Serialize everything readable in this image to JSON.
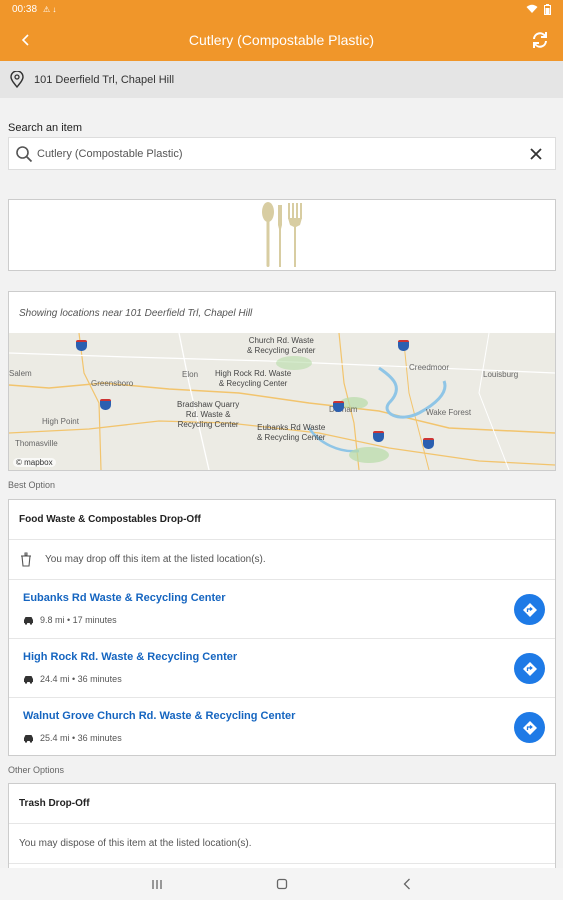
{
  "status": {
    "time": "00:38",
    "left_icons": "⚠ ↓"
  },
  "header": {
    "title": "Cutlery (Compostable Plastic)"
  },
  "address": {
    "text": "101 Deerfield Trl, Chapel Hill"
  },
  "search": {
    "label": "Search an item",
    "value": "Cutlery (Compostable Plastic)"
  },
  "map": {
    "near_text": "Showing locations near 101 Deerfield Trl, Chapel Hill",
    "markers": [
      {
        "label": "Church Rd. Waste\n& Recycling Center"
      },
      {
        "label": "High Rock Rd. Waste\n& Recycling Center"
      },
      {
        "label": "Bradshaw Quarry\nRd. Waste &\nRecycling Center"
      },
      {
        "label": "Eubanks Rd Waste\n& Recycling Center"
      }
    ],
    "cities": [
      "Salem",
      "Greensboro",
      "Elon",
      "High Point",
      "Durham",
      "Creedmoor",
      "Louisburg",
      "Wake Forest",
      "Thomasville"
    ],
    "attribution": "© mapbox"
  },
  "best_option": {
    "section_label": "Best Option",
    "title": "Food Waste & Compostables Drop-Off",
    "info": "You may drop off this item at the listed location(s).",
    "locations": [
      {
        "name": "Eubanks Rd Waste & Recycling Center",
        "meta": "9.8 mi • 17 minutes"
      },
      {
        "name": "High Rock Rd. Waste & Recycling Center",
        "meta": "24.4 mi • 36 minutes"
      },
      {
        "name": "Walnut Grove Church Rd. Waste & Recycling Center",
        "meta": "25.4 mi • 36 minutes"
      }
    ]
  },
  "other_options": {
    "section_label": "Other Options",
    "title": "Trash Drop-Off",
    "info": "You may dispose of this item at the listed location(s)."
  },
  "colors": {
    "brand": "#f0962a",
    "link": "#1565c0",
    "direction_button": "#1e7ae6"
  }
}
